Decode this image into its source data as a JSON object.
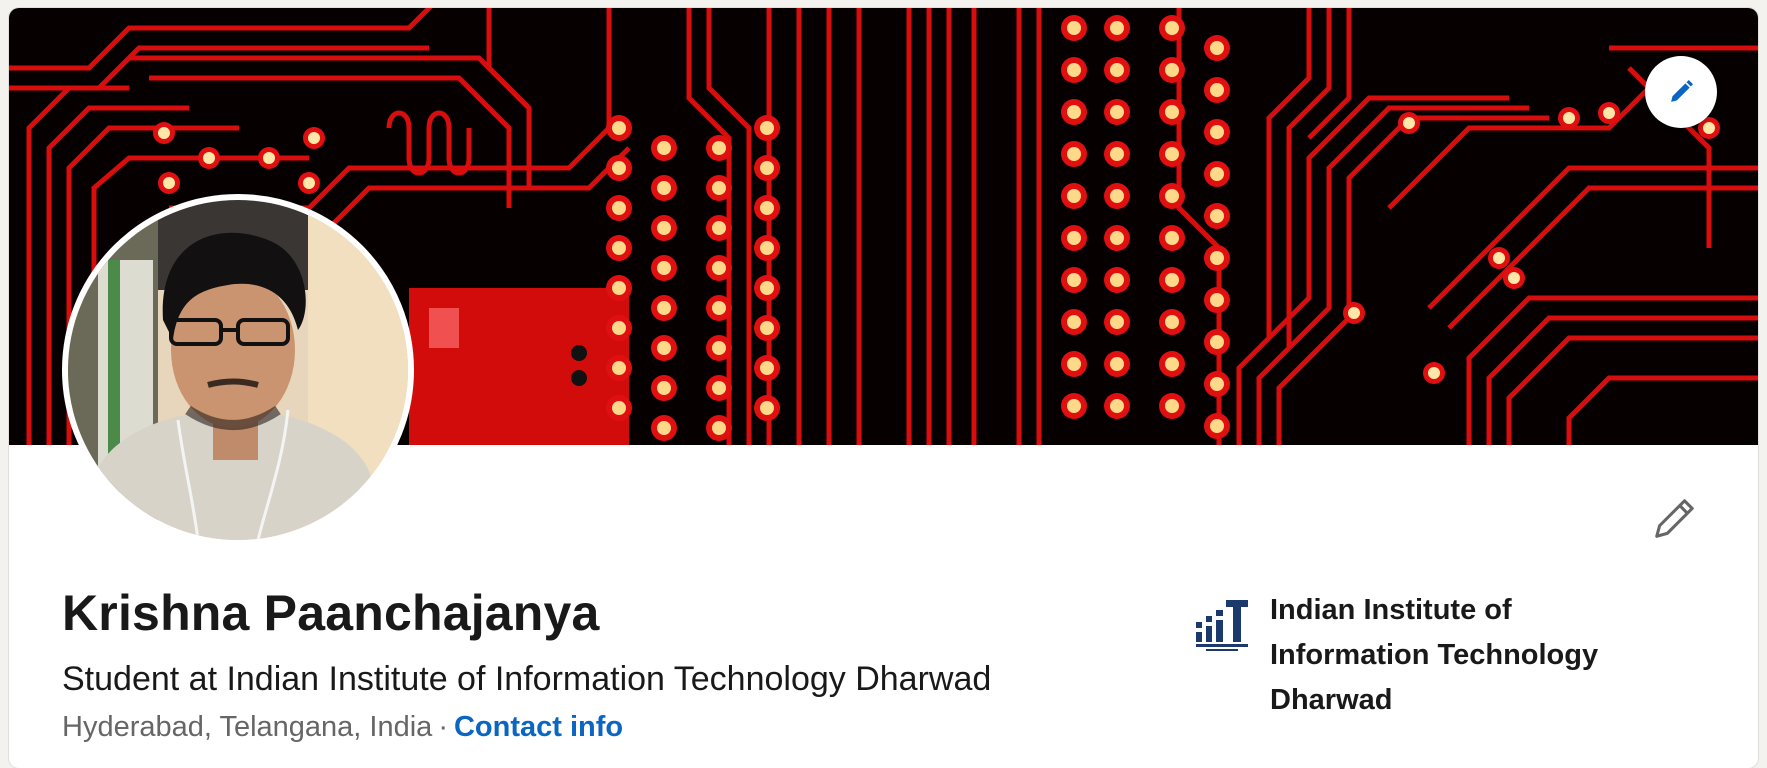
{
  "profile": {
    "name": "Krishna Paanchajanya",
    "headline": "Student at Indian Institute of Information Technology Dharwad",
    "location": "Hyderabad, Telangana, India",
    "separator": "·",
    "contact_info_label": "Contact info"
  },
  "education": {
    "name": "Indian Institute of Information Technology Dharwad"
  },
  "icons": {
    "banner_edit": "pencil-icon",
    "intro_edit": "pencil-icon"
  },
  "colors": {
    "link": "#0a66c2",
    "banner_edit_icon": "#0a66c2",
    "intro_edit_icon": "#666666",
    "banner_trace": "#e0100e",
    "banner_background": "#060000"
  }
}
